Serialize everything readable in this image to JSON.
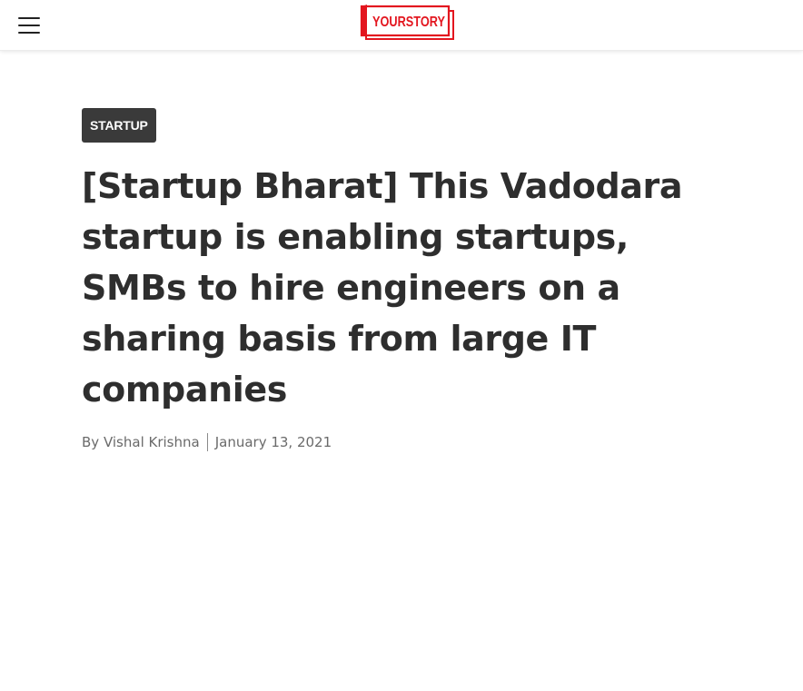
{
  "header": {
    "menu_icon": "hamburger-menu-icon",
    "logo_text": "YOURSTORY",
    "brand_color": "#e3161f"
  },
  "article": {
    "category": "STARTUP",
    "title": "[Startup Bharat] This Vadodara startup is enabling startups, SMBs to hire engineers on a sharing basis from large IT companies",
    "byline_prefix": "By",
    "author": "Vishal Krishna",
    "date": "January 13, 2021"
  },
  "colors": {
    "badge_bg": "#3a3a3a",
    "headline": "#2e2e2e",
    "meta": "#6a6a6a"
  }
}
